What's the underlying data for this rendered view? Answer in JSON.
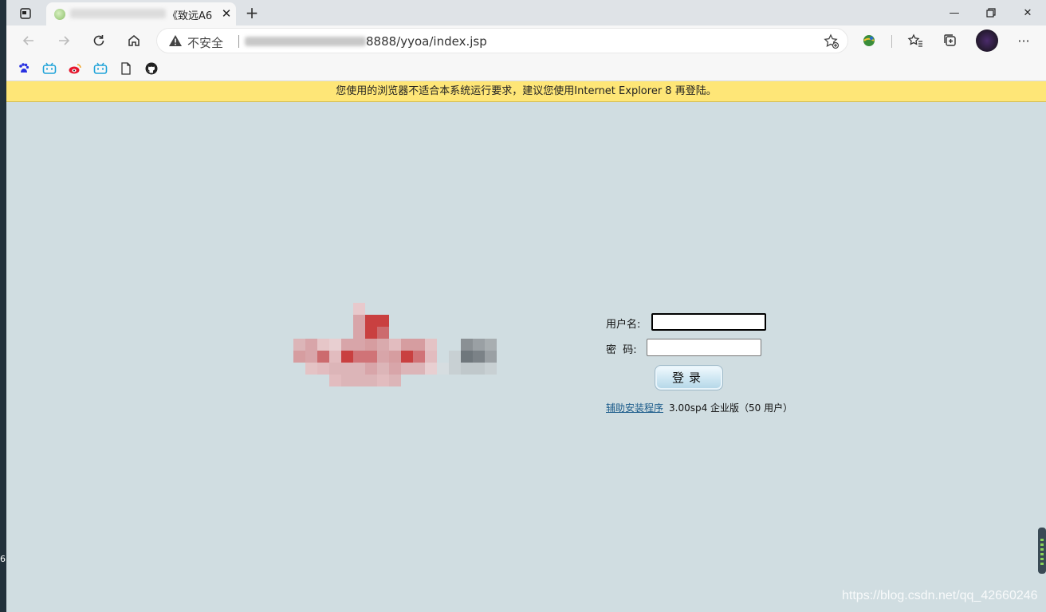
{
  "left_strip": {
    "digit": "6"
  },
  "tab": {
    "title": "《致远A6"
  },
  "toolbar": {
    "security_label": "不安全",
    "url": "8888/yyoa/index.jsp"
  },
  "notice": {
    "text": "您使用的浏览器不适合本系统运行要求，建议您使用Internet Explorer 8 再登陆。"
  },
  "login": {
    "username_label": "用户名:",
    "username_value": "",
    "password_label": "密  码:",
    "password_value": "",
    "submit_label": "登录",
    "helper_link": "辅助安装程序",
    "version_text": "3.00sp4 企业版（50 用户）"
  },
  "watermark": "https://blog.csdn.net/qq_42660246",
  "bookmarks": [
    "baidu-icon",
    "bilibili-icon",
    "weibo-icon",
    "bilibili-icon",
    "document-icon",
    "github-icon"
  ],
  "colors": {
    "page_bg": "#d0dde1",
    "notice_bg": "#fee677",
    "link": "#1a5b8a"
  }
}
